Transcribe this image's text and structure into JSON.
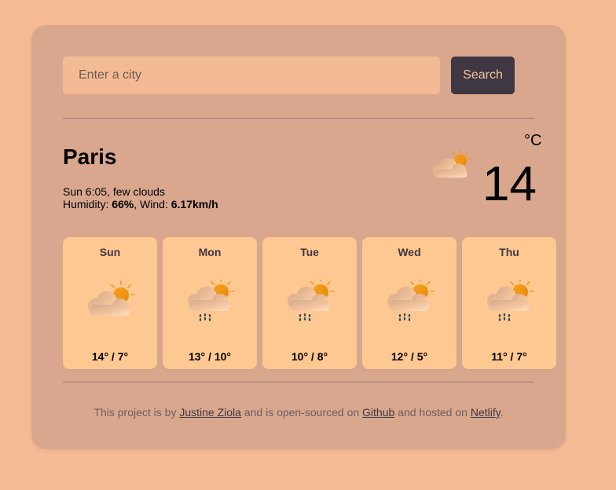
{
  "search": {
    "placeholder": "Enter a city",
    "value": "",
    "button_label": "Search"
  },
  "current": {
    "city": "Paris",
    "datetime_desc": "Sun 6:05, few clouds",
    "humidity_label": "Humidity: ",
    "humidity_value": "66%",
    "wind_label": ", Wind: ",
    "wind_value": "6.17km/h",
    "temperature": "14",
    "unit": "°C",
    "icon": "few-clouds-icon"
  },
  "forecast": [
    {
      "day": "Sun",
      "temps": "14° / 7°",
      "icon": "partly-cloudy-icon"
    },
    {
      "day": "Mon",
      "temps": "13° / 10°",
      "icon": "cloud-rain-icon"
    },
    {
      "day": "Tue",
      "temps": "10° / 8°",
      "icon": "cloud-rain-icon"
    },
    {
      "day": "Wed",
      "temps": "12° / 5°",
      "icon": "cloud-rain-icon"
    },
    {
      "day": "Thu",
      "temps": "11° / 7°",
      "icon": "cloud-rain-icon"
    }
  ],
  "footer": {
    "text_1": "This project is by ",
    "author_link": "Justine Ziola",
    "text_2": " and is open-sourced on ",
    "github_link": "Github",
    "text_3": " and hosted on ",
    "netlify_link": "Netlify",
    "text_4": "."
  },
  "colors": {
    "page_background": "#f4bb94",
    "card_background": "#d9a78e",
    "forecast_card": "#fec892",
    "button": "#3f3741",
    "sun": "#f09a1c"
  }
}
